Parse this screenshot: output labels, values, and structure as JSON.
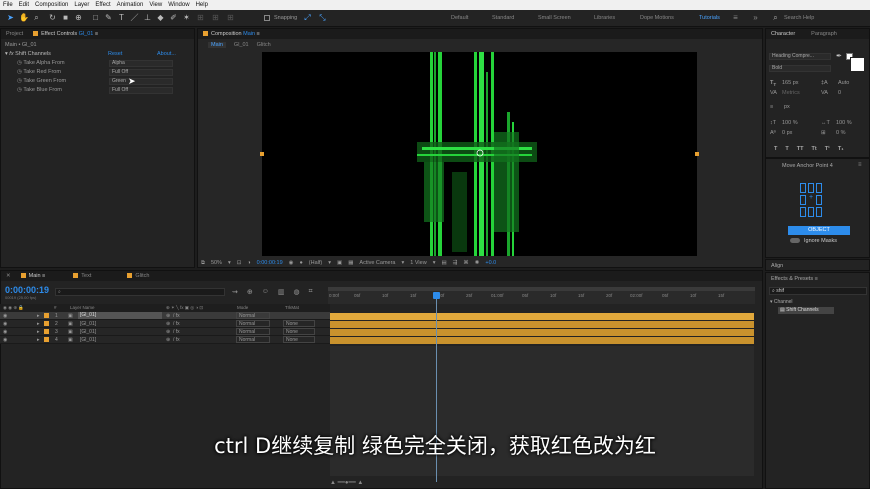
{
  "menu": [
    "File",
    "Edit",
    "Composition",
    "Layer",
    "Effect",
    "Animation",
    "View",
    "Window",
    "Help"
  ],
  "toolbar": {
    "snapping": "Snapping",
    "workspaces": [
      "Default",
      "Standard",
      "Small Screen",
      "Libraries",
      "Dope Motions",
      "Tutorials"
    ],
    "active_workspace": "Tutorials",
    "search_placeholder": "Search Help"
  },
  "left_panel": {
    "tabs": [
      "Project",
      "Effect Controls"
    ],
    "effect_controls_target": "Gl_01",
    "breadcrumb": "Main • Gl_01",
    "effect_name": "Shift Channels",
    "reset": "Reset",
    "about": "About...",
    "rows": [
      {
        "label": "Take Alpha From",
        "value": "Alpha"
      },
      {
        "label": "Take Red From",
        "value": "Full Off"
      },
      {
        "label": "Take Green From",
        "value": "Green"
      },
      {
        "label": "Take Blue From",
        "value": "Full Off"
      }
    ]
  },
  "composition": {
    "tab_label": "Composition",
    "comp_name": "Main",
    "subtabs": [
      "Main",
      "Gl_01",
      "Glitch"
    ],
    "zoom": "50%",
    "timecode": "0:00:00:19",
    "resolution": "(Half)",
    "camera": "Active Camera",
    "views": "1 View",
    "exposure": "+0.0"
  },
  "timeline": {
    "tabs": [
      "Main",
      "Text",
      "Glitch"
    ],
    "timecode": "0:00:00:19",
    "fps": "00019 (25.00 fps)",
    "column_headers": {
      "num": "#",
      "layer_name": "Layer Name",
      "mode": "Mode",
      "trkmat": "TrkMat"
    },
    "layers": [
      {
        "num": "1",
        "name": "[Gl_01]",
        "mode": "Normal",
        "trkmat": ""
      },
      {
        "num": "2",
        "name": "[Gl_01]",
        "mode": "Normal",
        "trkmat": "None"
      },
      {
        "num": "3",
        "name": "[Gl_01]",
        "mode": "Normal",
        "trkmat": "None"
      },
      {
        "num": "4",
        "name": "[Gl_01]",
        "mode": "Normal",
        "trkmat": "None"
      }
    ],
    "ruler_labels": [
      "0:00f",
      "05f",
      "10f",
      "15f",
      "20f",
      "25f",
      "01:00f",
      "05f",
      "10f",
      "15f",
      "20f",
      "02:00f",
      "05f",
      "10f",
      "15f"
    ]
  },
  "character": {
    "tabs": [
      "Character",
      "Paragraph"
    ],
    "font": "Heading Compre...",
    "style": "Bold",
    "size": "165 px",
    "leading": "Auto",
    "kerning": "Metrics",
    "tracking": "0",
    "stroke_unit": "px",
    "vscale": "100 %",
    "hscale": "100 %",
    "baseline": "0 px",
    "tsume": "0 %",
    "styles": [
      "T",
      "T",
      "TT",
      "Tt",
      "T¹",
      "T₁"
    ]
  },
  "anchor": {
    "title": "Move Anchor Point 4",
    "button": "OBJECT",
    "ignore_masks": "Ignore Masks"
  },
  "align": {
    "title": "Align"
  },
  "effects_presets": {
    "title": "Effects & Presets",
    "search": "shif",
    "category": "Channel",
    "result": "Shift Channels"
  },
  "subtitle": "ctrl D继续复制 绿色完全关闭，获取红色改为红",
  "colors": {
    "accent": "#2d8ceb",
    "layer_bar": "#c9922d",
    "glitch_green": "#25d33a",
    "orange": "#e8a030"
  }
}
